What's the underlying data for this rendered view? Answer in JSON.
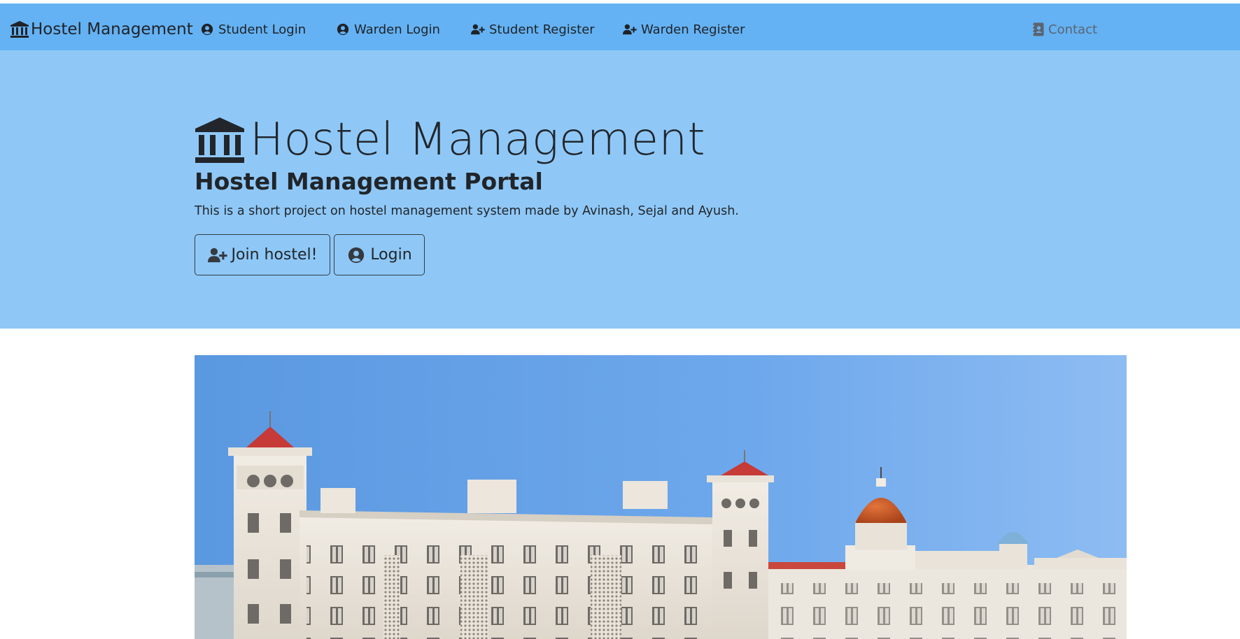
{
  "navbar": {
    "brand": "Hostel Management",
    "items": [
      {
        "label": "Student Login",
        "icon": "user-circle-icon"
      },
      {
        "label": "Warden Login",
        "icon": "user-circle-icon"
      },
      {
        "label": "Student Register",
        "icon": "user-plus-icon"
      },
      {
        "label": "Warden Register",
        "icon": "user-plus-icon"
      }
    ],
    "contact": {
      "label": "Contact",
      "icon": "contact-card-icon"
    }
  },
  "hero": {
    "title": "Hostel Management",
    "subtitle": "Hostel Management Portal",
    "description": "This is a short project on hostel management system made by Avinash, Sejal and Ayush.",
    "join_button": "Join hostel!",
    "login_button": "Login"
  },
  "colors": {
    "navbar_bg": "#64b2f3",
    "hero_bg": "#8fc8f7",
    "dome": "#c8551f",
    "roof": "#c8413a"
  }
}
